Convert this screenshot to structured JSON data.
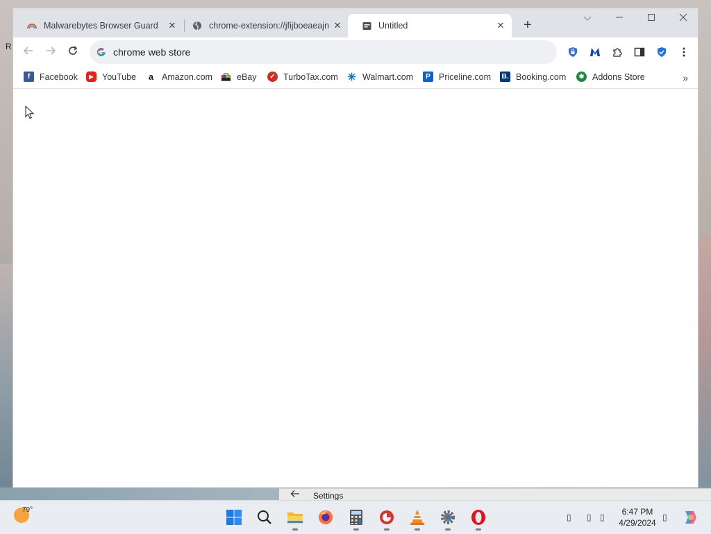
{
  "desktop": {
    "partial_label": "R"
  },
  "browser": {
    "tabs": [
      {
        "title": "Malwarebytes Browser Guard",
        "icon": "rainbow-icon",
        "active": false
      },
      {
        "title": "chrome-extension://jfijboeaeajn",
        "icon": "globe-icon",
        "active": false
      },
      {
        "title": "Untitled",
        "icon": "page-icon",
        "active": true
      }
    ],
    "new_tab_symbol": "+",
    "omnibox": {
      "text": "chrome web store",
      "icon": "google-icon"
    },
    "extensions": [
      "bitwarden-icon",
      "malwarebytes-icon",
      "puzzle-icon",
      "sidepanel-icon",
      "shield-icon",
      "kebab-menu-icon"
    ],
    "bookmarks": [
      {
        "label": "Facebook",
        "icon": "facebook-icon",
        "color": "#3b5998"
      },
      {
        "label": "YouTube",
        "icon": "youtube-icon",
        "color": "#e62117"
      },
      {
        "label": "Amazon.com",
        "icon": "amazon-icon",
        "color": "#222222"
      },
      {
        "label": "eBay",
        "icon": "ebay-icon",
        "color": "#e53238"
      },
      {
        "label": "TurboTax.com",
        "icon": "turbotax-icon",
        "color": "#d52b1e"
      },
      {
        "label": "Walmart.com",
        "icon": "walmart-icon",
        "color": "#0071ce"
      },
      {
        "label": "Priceline.com",
        "icon": "priceline-icon",
        "color": "#0a63d6"
      },
      {
        "label": "Booking.com",
        "icon": "booking-icon",
        "color": "#003580"
      },
      {
        "label": "Addons Store",
        "icon": "addons-icon",
        "color": "#1a8a3c"
      }
    ],
    "bookmarks_more": "»"
  },
  "settings_strip": {
    "label": "Settings"
  },
  "taskbar": {
    "weather": {
      "temp": "79°"
    },
    "apps": [
      "windows-start-icon",
      "search-icon",
      "file-explorer-icon",
      "firefox-icon",
      "calculator-icon",
      "cleaner-icon",
      "vlc-icon",
      "settings-gear-icon",
      "opera-icon"
    ],
    "clock": {
      "time": "6:47 PM",
      "date": "4/29/2024"
    }
  }
}
